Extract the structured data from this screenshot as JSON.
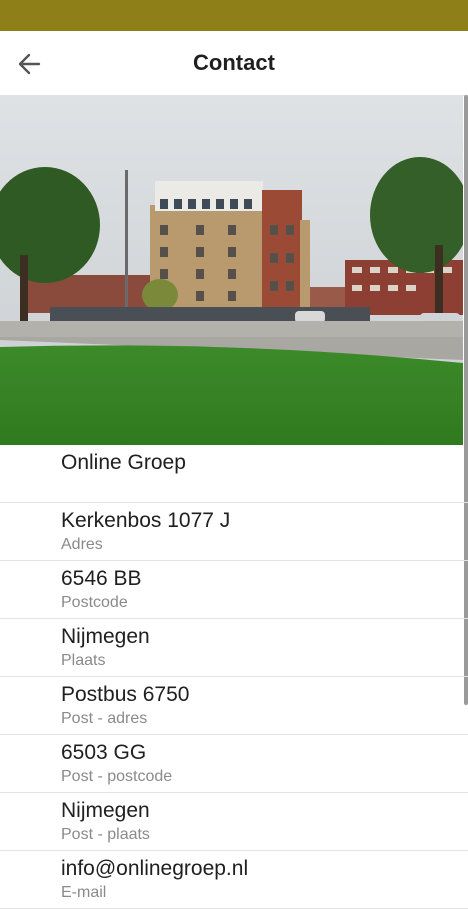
{
  "header": {
    "title": "Contact"
  },
  "contact": [
    {
      "value": "Online Groep",
      "label": ""
    },
    {
      "value": "Kerkenbos 1077 J",
      "label": "Adres"
    },
    {
      "value": "6546 BB",
      "label": "Postcode"
    },
    {
      "value": "Nijmegen",
      "label": "Plaats"
    },
    {
      "value": "Postbus 6750",
      "label": "Post - adres"
    },
    {
      "value": "6503 GG",
      "label": "Post - postcode"
    },
    {
      "value": "Nijmegen",
      "label": "Post - plaats"
    },
    {
      "value": "info@onlinegroep.nl",
      "label": "E-mail"
    }
  ],
  "colors": {
    "status_bar": "#8f7f19"
  },
  "icons": {
    "back": "arrow-left-icon"
  }
}
